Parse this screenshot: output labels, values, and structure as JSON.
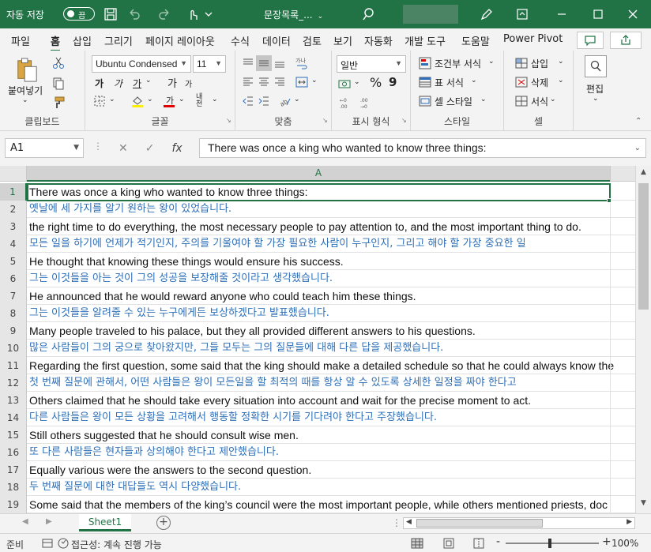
{
  "titlebar": {
    "autosave_label": "자동 저장",
    "toggle_label": "끔",
    "document_name": "문장목록_...",
    "caret": "⌄"
  },
  "menu": {
    "tabs": [
      "파일",
      "홈",
      "삽입",
      "그리기",
      "페이지 레이아웃",
      "수식",
      "데이터",
      "검토",
      "보기",
      "자동화",
      "개발 도구",
      "도움말",
      "Power Pivot"
    ],
    "active": "홈"
  },
  "ribbon": {
    "clipboard": {
      "paste_label": "붙여넣기",
      "group_label": "클립보드"
    },
    "font": {
      "font_name": "Ubuntu Condensed",
      "font_size": "11",
      "bold": "가",
      "italic": "가",
      "underline": "가",
      "grow": "가",
      "shrink": "가",
      "phonetic": "내천",
      "group_label": "글꼴"
    },
    "alignment": {
      "group_label": "맞춤"
    },
    "number": {
      "format": "일반",
      "group_label": "표시 형식",
      "percent": "%",
      "comma": "9"
    },
    "styles": {
      "conditional": "조건부 서식",
      "table": "표 서식",
      "cell": "셀 스타일",
      "group_label": "스타일"
    },
    "cells": {
      "insert": "삽입",
      "delete": "삭제",
      "format": "서식",
      "group_label": "셀"
    },
    "editing": {
      "label": "편집"
    }
  },
  "formula_bar": {
    "name_box": "A1",
    "fx": "fx",
    "content": "There was once a king who wanted to know three things:"
  },
  "grid": {
    "column_header": "A",
    "rows": [
      {
        "n": "1",
        "text": "There was once a king who wanted to know three things:",
        "lang": "en"
      },
      {
        "n": "2",
        "text": "옛날에 세 가지를 알기 원하는 왕이 있었습니다.",
        "lang": "ko"
      },
      {
        "n": "3",
        "text": "the right time to do everything, the most necessary people to pay attention to, and the most important thing to do.",
        "lang": "en"
      },
      {
        "n": "4",
        "text": "모든 일을 하기에 언제가 적기인지, 주의를 기울여야 할 가장 필요한 사람이 누구인지, 그리고 해야 할 가장 중요한 일",
        "lang": "ko"
      },
      {
        "n": "5",
        "text": "He thought that knowing these things would ensure his success.",
        "lang": "en"
      },
      {
        "n": "6",
        "text": "그는 이것들을 아는 것이 그의 성공을 보장해줄 것이라고 생각했습니다.",
        "lang": "ko"
      },
      {
        "n": "7",
        "text": "He announced that he would reward anyone who could teach him these things.",
        "lang": "en"
      },
      {
        "n": "8",
        "text": "그는 이것들을 알려줄 수 있는 누구에게든 보상하겠다고 발표했습니다.",
        "lang": "ko"
      },
      {
        "n": "9",
        "text": "Many people traveled to his palace, but they all provided different answers to his questions.",
        "lang": "en"
      },
      {
        "n": "10",
        "text": "많은 사람들이 그의 궁으로 찾아왔지만, 그들 모두는 그의 질문들에 대해 다른 답을 제공했습니다.",
        "lang": "ko"
      },
      {
        "n": "11",
        "text": "Regarding the first question, some said that the king should make a detailed schedule so that he could always know the",
        "lang": "en"
      },
      {
        "n": "12",
        "text": "첫 번째 질문에 관해서, 어떤 사람들은 왕이 모든일을 할 최적의 때를 항상 알 수 있도록 상세한 일정을 짜야 한다고",
        "lang": "ko"
      },
      {
        "n": "13",
        "text": "Others claimed that he should take every situation into account and wait for the precise moment to act.",
        "lang": "en"
      },
      {
        "n": "14",
        "text": "다른 사람들은 왕이 모든 상황을 고려해서 행동할 정확한 시기를 기다려야 한다고 주장했습니다.",
        "lang": "ko"
      },
      {
        "n": "15",
        "text": "Still others suggested that he should consult wise men.",
        "lang": "en"
      },
      {
        "n": "16",
        "text": "또 다른 사람들은 현자들과 상의해야 한다고 제안했습니다.",
        "lang": "ko"
      },
      {
        "n": "17",
        "text": "Equally various were the answers to the second question.",
        "lang": "en"
      },
      {
        "n": "18",
        "text": "두 번째 질문에 대한 대답들도 역시 다양했습니다.",
        "lang": "ko"
      },
      {
        "n": "19",
        "text": "Some said that the members of the king’s council were the most important people, while others mentioned priests, doc",
        "lang": "en"
      }
    ]
  },
  "sheets": {
    "tabs": [
      "Sheet1"
    ],
    "add": "+",
    "sep": "⋮"
  },
  "statusbar": {
    "ready": "준비",
    "accessibility": "접근성: 계속 진행 가능",
    "zoom": "100%",
    "minus": "-",
    "plus": "+"
  },
  "colors": {
    "accent": "#217346",
    "korean_text": "#2e6fb7"
  }
}
